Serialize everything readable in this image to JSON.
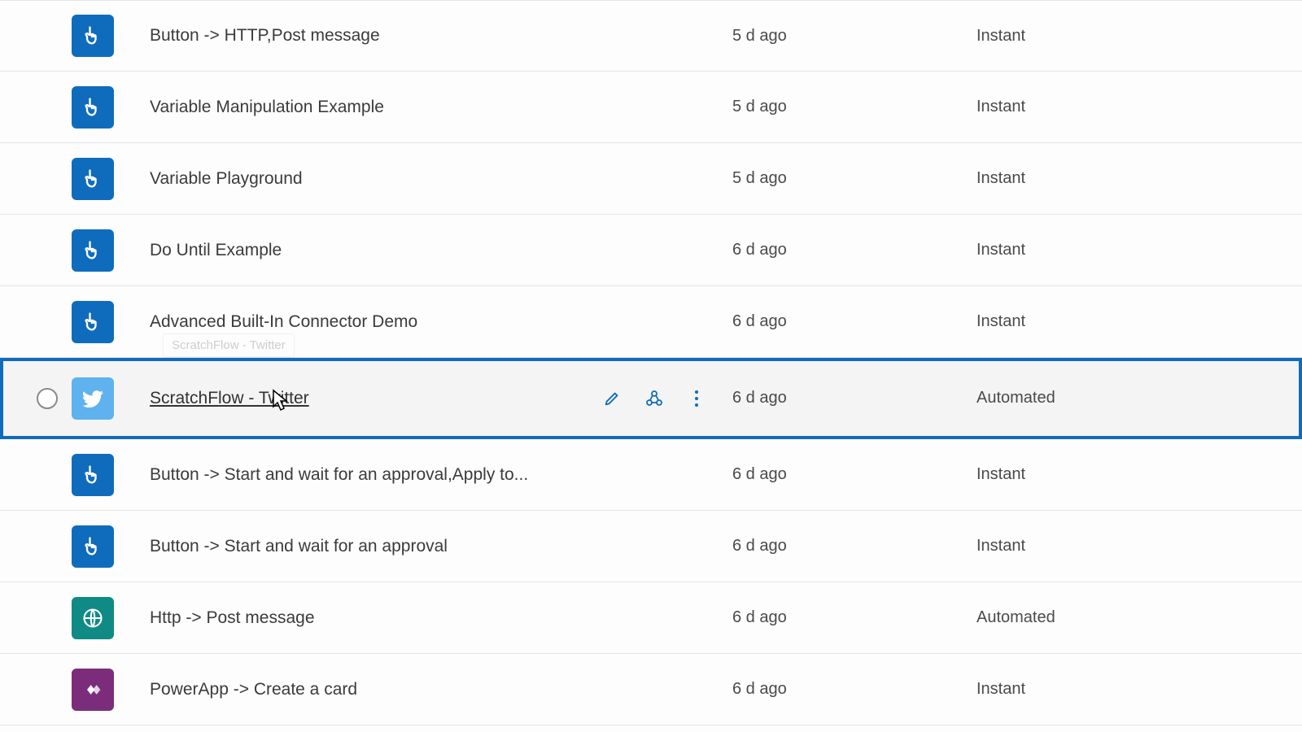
{
  "rows": [
    {
      "name": "Button -> HTTP,Post message",
      "modified": "5 d ago",
      "type": "Instant",
      "icon": "button",
      "selected": false
    },
    {
      "name": "Variable Manipulation Example",
      "modified": "5 d ago",
      "type": "Instant",
      "icon": "button",
      "selected": false
    },
    {
      "name": "Variable Playground",
      "modified": "5 d ago",
      "type": "Instant",
      "icon": "button",
      "selected": false
    },
    {
      "name": "Do Until Example",
      "modified": "6 d ago",
      "type": "Instant",
      "icon": "button",
      "selected": false
    },
    {
      "name": "Advanced Built-In Connector Demo",
      "modified": "6 d ago",
      "type": "Instant",
      "icon": "button",
      "selected": false
    },
    {
      "name": "ScratchFlow - Twitter",
      "modified": "6 d ago",
      "type": "Automated",
      "icon": "twitter",
      "selected": true,
      "tooltip": "ScratchFlow - Twitter"
    },
    {
      "name": "Button -> Start and wait for an approval,Apply to...",
      "modified": "6 d ago",
      "type": "Instant",
      "icon": "button",
      "selected": false
    },
    {
      "name": "Button -> Start and wait for an approval",
      "modified": "6 d ago",
      "type": "Instant",
      "icon": "button",
      "selected": false
    },
    {
      "name": "Http -> Post message",
      "modified": "6 d ago",
      "type": "Automated",
      "icon": "http",
      "selected": false
    },
    {
      "name": "PowerApp -> Create a card",
      "modified": "6 d ago",
      "type": "Instant",
      "icon": "powerapp",
      "selected": false
    }
  ]
}
